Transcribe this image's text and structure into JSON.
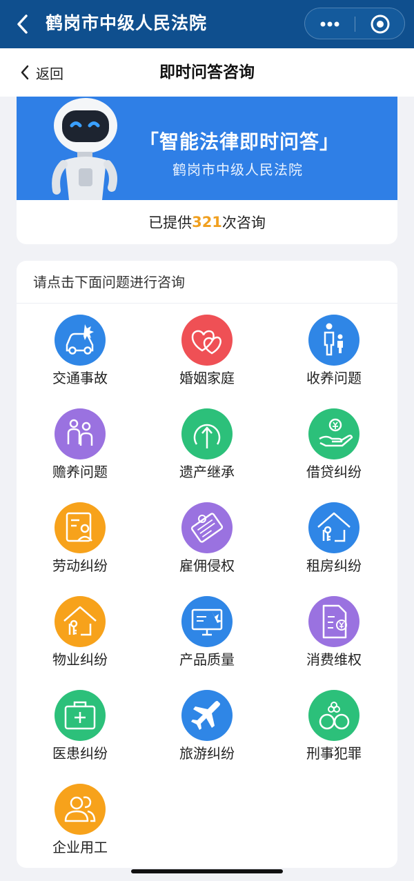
{
  "app": {
    "title": "鹤岗市中级人民法院"
  },
  "nav": {
    "back_label": "返回",
    "page_title": "即时问答咨询"
  },
  "banner": {
    "title": "「智能法律即时问答」",
    "subtitle": "鹤岗市中级人民法院"
  },
  "stats": {
    "prefix": "已提供",
    "count": "321",
    "suffix": "次咨询"
  },
  "categories": {
    "heading": "请点击下面问题进行咨询",
    "items": [
      {
        "label": "交通事故",
        "icon": "car-icon",
        "color": "#2f86e6"
      },
      {
        "label": "婚姻家庭",
        "icon": "hearts-icon",
        "color": "#ef5055"
      },
      {
        "label": "收养问题",
        "icon": "parent-child-icon",
        "color": "#2f86e6"
      },
      {
        "label": "赡养问题",
        "icon": "elderly-icon",
        "color": "#9a72e0"
      },
      {
        "label": "遗产继承",
        "icon": "inheritance-icon",
        "color": "#2cc07a"
      },
      {
        "label": "借贷纠纷",
        "icon": "loan-icon",
        "color": "#2cc07a"
      },
      {
        "label": "劳动纠纷",
        "icon": "worker-card-icon",
        "color": "#f7a21b"
      },
      {
        "label": "雇佣侵权",
        "icon": "contract-icon",
        "color": "#9a72e0"
      },
      {
        "label": "租房纠纷",
        "icon": "house-key-icon",
        "color": "#2f86e6"
      },
      {
        "label": "物业纠纷",
        "icon": "property-icon",
        "color": "#f7a21b"
      },
      {
        "label": "产品质量",
        "icon": "monitor-icon",
        "color": "#2f86e6"
      },
      {
        "label": "消费维权",
        "icon": "receipt-icon",
        "color": "#9a72e0"
      },
      {
        "label": "医患纠纷",
        "icon": "medical-kit-icon",
        "color": "#2cc07a"
      },
      {
        "label": "旅游纠纷",
        "icon": "airplane-icon",
        "color": "#2f86e6"
      },
      {
        "label": "刑事犯罪",
        "icon": "handcuffs-icon",
        "color": "#2cc07a"
      },
      {
        "label": "企业用工",
        "icon": "users-icon",
        "color": "#f7a21b"
      }
    ]
  }
}
